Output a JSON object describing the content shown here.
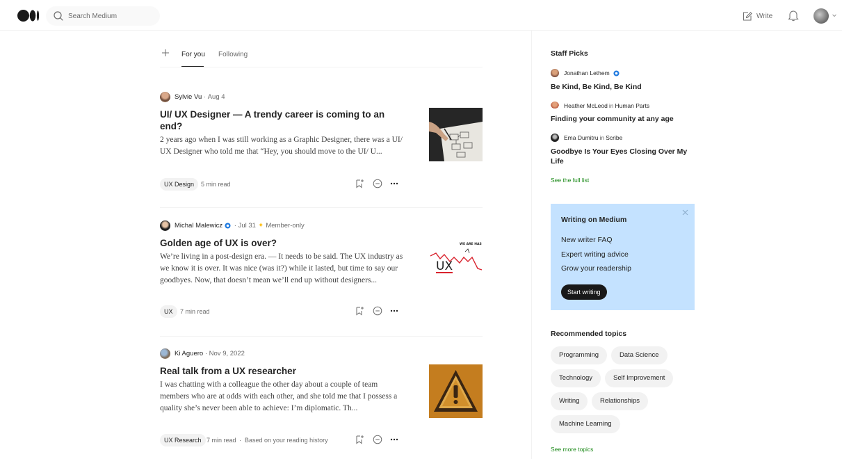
{
  "header": {
    "search_placeholder": "Search Medium",
    "write_label": "Write"
  },
  "feed": {
    "tabs": [
      {
        "label": "For you"
      },
      {
        "label": "Following"
      }
    ],
    "articles": [
      {
        "author": "Sylvie Vu",
        "date": "Aug 4",
        "title": "UI/ UX Designer — A trendy career is coming to an end?",
        "snippet": "2 years ago when I was still working as a Graphic Designer, there was a UI/ UX Designer who told me that “Hey, you should move to the UI/ U...",
        "tag": "UX Design",
        "read_time": "5 min read"
      },
      {
        "author": "Michal Malewicz",
        "date": "Jul 31",
        "member": "Member-only",
        "title": "Golden age of UX is over?",
        "snippet": "We’re living in a post-design era. — It needs to be said. The UX industry as we know it is over. It was nice (was it?) while it lasted, but time to say our goodbyes. Now, that doesn’t mean we’ll end up without designers...",
        "tag": "UX",
        "read_time": "7 min read",
        "thumb_text": "UX",
        "thumb_small": "WE ARE HAS"
      },
      {
        "author": "Ki Aguero",
        "date": "Nov 9, 2022",
        "title": "Real talk from a UX researcher",
        "snippet": "I was chatting with a colleague the other day about a couple of team members who are at odds with each other, and she told me that I possess a quality she’s never been able to achieve: I’m diplomatic. Th...",
        "tag": "UX Research",
        "read_time": "7 min read",
        "reason": "Based on your reading history"
      }
    ]
  },
  "sidebar": {
    "staff_picks_heading": "Staff Picks",
    "picks": [
      {
        "author": "Jonathan Lethem",
        "publication": "",
        "title": "Be Kind, Be Kind, Be Kind"
      },
      {
        "author": "Heather McLeod",
        "in": "in",
        "publication": "Human Parts",
        "title": "Finding your community at any age"
      },
      {
        "author": "Ema Dumitru",
        "in": "in",
        "publication": "Scribe",
        "title": "Goodbye Is Your Eyes Closing Over My Life"
      }
    ],
    "see_full_list": "See the full list",
    "promo": {
      "heading": "Writing on Medium",
      "links": [
        "New writer FAQ",
        "Expert writing advice",
        "Grow your readership"
      ],
      "button": "Start writing",
      "bg_color": "#c4e2ff"
    },
    "topics_heading": "Recommended topics",
    "topics": [
      "Programming",
      "Data Science",
      "Technology",
      "Self Improvement",
      "Writing",
      "Relationships",
      "Machine Learning"
    ],
    "see_more_topics": "See more topics"
  },
  "colors": {
    "accent_green": "#1a8917",
    "member_star": "#ffc017",
    "verified_blue": "#1f7ae0"
  }
}
